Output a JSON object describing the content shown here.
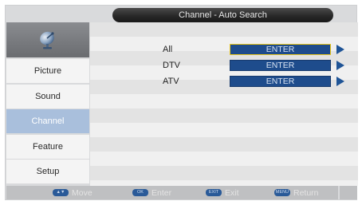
{
  "title": "Channel - Auto Search",
  "header_icon": "satellite-dish-icon",
  "sidebar": {
    "items": [
      {
        "label": "Picture",
        "active": false
      },
      {
        "label": "Sound",
        "active": false
      },
      {
        "label": "Channel",
        "active": true
      },
      {
        "label": "Feature",
        "active": false
      },
      {
        "label": "Setup",
        "active": false
      }
    ]
  },
  "search_options": [
    {
      "label": "All",
      "button": "ENTER",
      "selected": true
    },
    {
      "label": "DTV",
      "button": "ENTER",
      "selected": false
    },
    {
      "label": "ATV",
      "button": "ENTER",
      "selected": false
    }
  ],
  "footer_hints": [
    {
      "key": "▲▼",
      "label": "Move"
    },
    {
      "key": "OK",
      "label": "Enter"
    },
    {
      "key": "EXIT",
      "label": "Exit"
    },
    {
      "key": "MENU",
      "label": "Return"
    }
  ],
  "colors": {
    "button_blue": "#1e4c8c",
    "selected_border": "#e8c51a",
    "active_sidebar": "#a9bfdc",
    "arrow_blue": "#1f5496"
  }
}
